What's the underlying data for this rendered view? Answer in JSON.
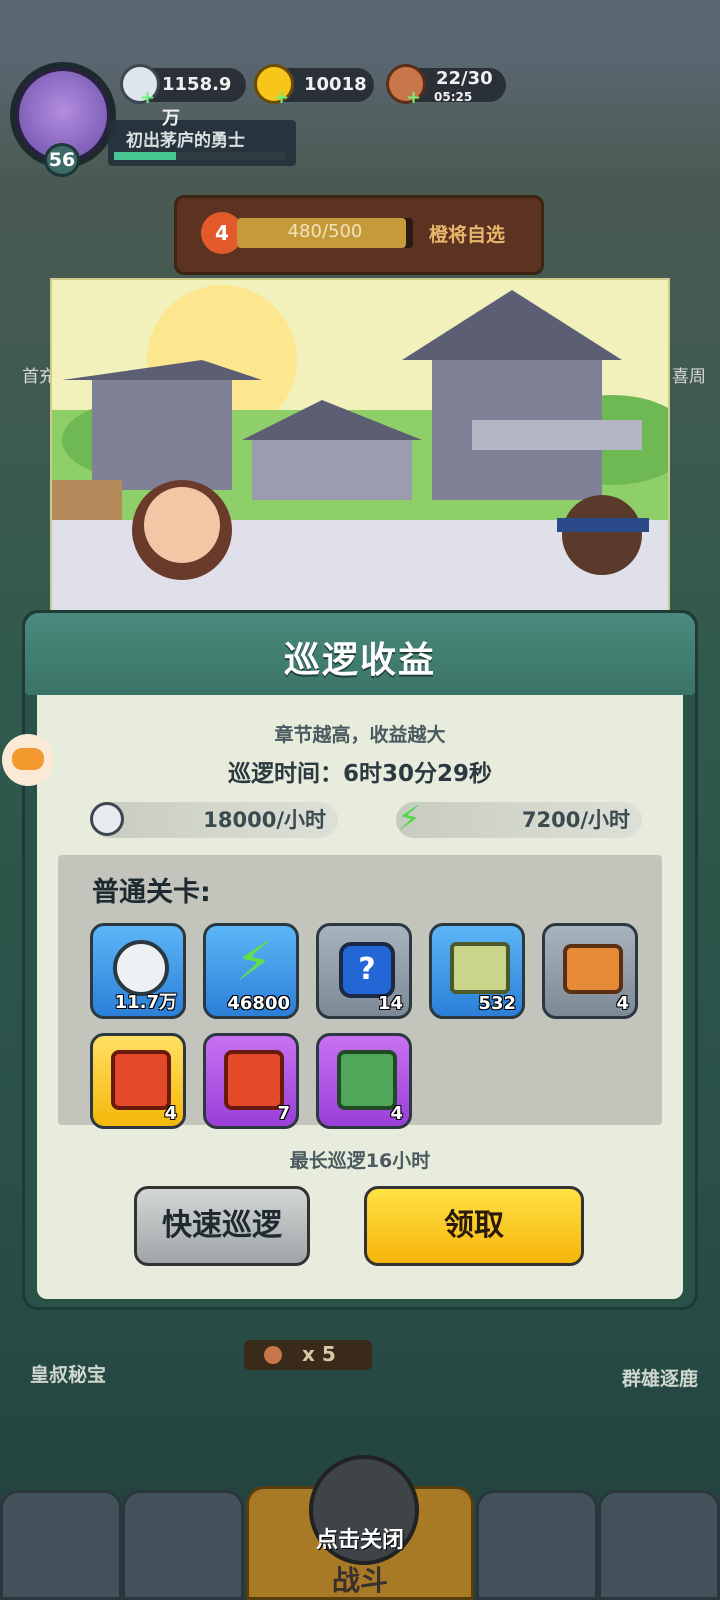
{
  "hud": {
    "level": "56",
    "player_title": "初出茅庐的勇士",
    "xp_percent": 36,
    "coins": "1158.9万",
    "ingots": "10018",
    "stamina": "22/30",
    "stamina_timer": "05:25"
  },
  "behind": {
    "badge": "4",
    "progress": "480/500",
    "progress_fraction": 0.96,
    "button": "橙将自选",
    "left_label": "首充",
    "right_label": "喜周",
    "bottom_left": "皇叔秘宝",
    "bottom_right": "群雄逐鹿",
    "battle_count": "x 5",
    "close_hint": "点击关闭",
    "battle": "战斗"
  },
  "dialog": {
    "title": "巡逻收益",
    "subtitle": "章节越高，收益越大",
    "patrol_time": "巡逻时间：6时30分29秒",
    "coin_rate": "18000/小时",
    "energy_rate": "7200/小时",
    "section": "普通关卡:",
    "items": [
      {
        "name": "coin-icon",
        "count": "11.7万",
        "style": "blue"
      },
      {
        "name": "energy-icon",
        "count": "46800",
        "style": "blue"
      },
      {
        "name": "mystery-gem-icon",
        "count": "14",
        "style": "gray"
      },
      {
        "name": "scroll-icon",
        "count": "532",
        "style": "blue"
      },
      {
        "name": "chest-icon",
        "count": "4",
        "style": "gray"
      },
      {
        "name": "gold-treasure-icon",
        "count": "4",
        "style": "gold"
      },
      {
        "name": "purple-treasure-icon",
        "count": "7",
        "style": "purple"
      },
      {
        "name": "jade-seal-icon",
        "count": "4",
        "style": "purple"
      }
    ],
    "max_note": "最长巡逻16小时",
    "quick_patrol": "快速巡逻",
    "claim": "领取"
  }
}
